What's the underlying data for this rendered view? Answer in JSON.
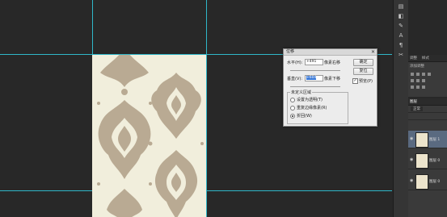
{
  "dialog": {
    "title": "位移",
    "close_glyph": "✕",
    "horizontal_label": "水平(H):",
    "horizontal_value": "+491",
    "horizontal_unit": "像素右移",
    "vertical_label": "垂直(V):",
    "vertical_value": "+604",
    "vertical_unit": "像素下移",
    "ok_label": "确定",
    "reset_label": "复位",
    "preview_label": "预览(P)",
    "preview_checked": true,
    "undefined_area_label": "未定义区域",
    "options": [
      {
        "label": "设置为透明(T)",
        "selected": false
      },
      {
        "label": "重复边缘像素(R)",
        "selected": false
      },
      {
        "label": "折回(W)",
        "selected": true
      }
    ]
  },
  "panels": {
    "top_tabs": [
      "调整",
      "样式"
    ],
    "top_subtitle": "添加调整",
    "layers_tab": "图层",
    "layers_mode": "正常",
    "layers": [
      {
        "name": "图层 1",
        "selected": true
      },
      {
        "name": "图层 0",
        "selected": false
      },
      {
        "name": "图层 0",
        "selected": false
      }
    ]
  },
  "toolbar_icons": [
    "layers-icon",
    "history-icon",
    "brush-icon",
    "type-icon",
    "text-align-icon",
    "tools-icon"
  ],
  "colors": {
    "canvas_bg": "#282828",
    "guide": "#2fb7c9",
    "paper": "#f1eedc",
    "pattern": "#b9aa93"
  }
}
